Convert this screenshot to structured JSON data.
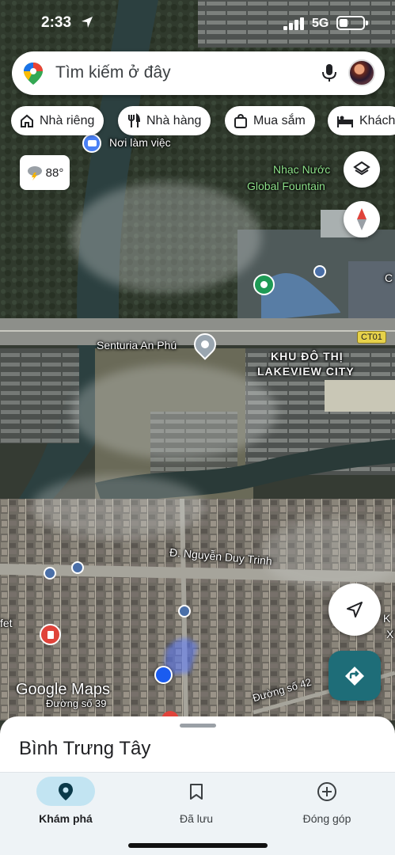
{
  "status_bar": {
    "time": "2:33",
    "network": "5G"
  },
  "search": {
    "placeholder": "Tìm kiếm ở đây",
    "icons": [
      "google-maps-pin-icon",
      "mic-icon",
      "avatar"
    ]
  },
  "chips": [
    {
      "label": "Nhà riêng",
      "icon": "home-icon"
    },
    {
      "label": "Nhà hàng",
      "icon": "restaurant-icon"
    },
    {
      "label": "Mua sắm",
      "icon": "shopping-bag-icon"
    },
    {
      "label": "Khách",
      "icon": "bed-icon"
    }
  ],
  "weather": {
    "temperature": "88°",
    "icon": "thunderstorm-icon"
  },
  "map": {
    "labels": {
      "workplace": "Nơi làm việc",
      "fountain_line1": "Nhạc Nước",
      "fountain_line2": "Global Fountain",
      "senturia": "Senturia An Phú",
      "kdt_line1": "KHU ĐÔ THỊ",
      "kdt_line2": "LAKEVIEW CITY",
      "road_ct01": "CT01",
      "road_nguyen_duy_trinh": "Đ. Nguyễn Duy Trinh",
      "road_42": "Đường số 42",
      "road_39": "Đường số 39",
      "left_edge": "fet",
      "right_edge_c": "C",
      "right_edge_k": "K",
      "right_edge_x": "X"
    },
    "colors": {
      "route_label_bg": "#e7d24a",
      "my_location": "#1a5cf0",
      "accent_teal": "#1e6d78"
    }
  },
  "watermark": "Google Maps",
  "place_sheet": {
    "title": "Bình Trưng Tây"
  },
  "bottom_nav": [
    {
      "label": "Khám phá",
      "icon": "explore-pin-icon",
      "active": true
    },
    {
      "label": "Đã lưu",
      "icon": "bookmark-icon",
      "active": false
    },
    {
      "label": "Đóng góp",
      "icon": "add-circle-icon",
      "active": false
    }
  ]
}
